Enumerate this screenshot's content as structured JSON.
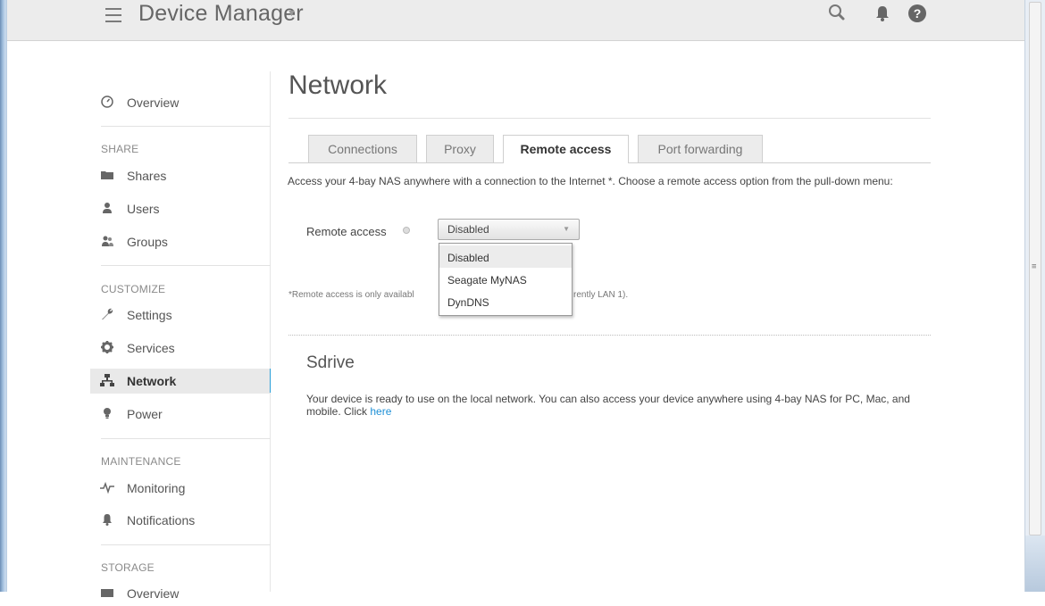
{
  "header": {
    "app_title": "Device Manager",
    "icons": [
      "menu-icon",
      "search-icon",
      "bell-icon",
      "help-icon"
    ]
  },
  "sidebar": {
    "overview": "Overview",
    "sections": {
      "share": "SHARE",
      "customize": "CUSTOMIZE",
      "maintenance": "MAINTENANCE",
      "storage": "STORAGE"
    },
    "items": {
      "shares": "Shares",
      "users": "Users",
      "groups": "Groups",
      "settings": "Settings",
      "services": "Services",
      "network": "Network",
      "power": "Power",
      "monitoring": "Monitoring",
      "notifications": "Notifications",
      "storage_overview": "Overview"
    },
    "active_item": "Network",
    "accent_color": "#2a9fd8"
  },
  "main": {
    "title": "Network",
    "tabs": [
      "Connections",
      "Proxy",
      "Remote access",
      "Port forwarding"
    ],
    "active_tab": "Remote access",
    "description": "Access your 4-bay NAS anywhere with a connection to the Internet *. Choose a remote access option from the pull-down menu:",
    "remote_access_label": "Remote access",
    "select_value": "Disabled",
    "dropdown_options": [
      "Disabled",
      "Seagate MyNAS",
      "DynDNS"
    ],
    "note_part1": "*Remote access is only availabl",
    "note_part2": "rently LAN 1).",
    "sdrive": {
      "title": "Sdrive",
      "text": "Your device is ready to use on the local network. You can also access your device anywhere using 4-bay NAS for PC, Mac, and mobile. Click ",
      "link": "here",
      "link_color": "#1e90d6"
    }
  }
}
